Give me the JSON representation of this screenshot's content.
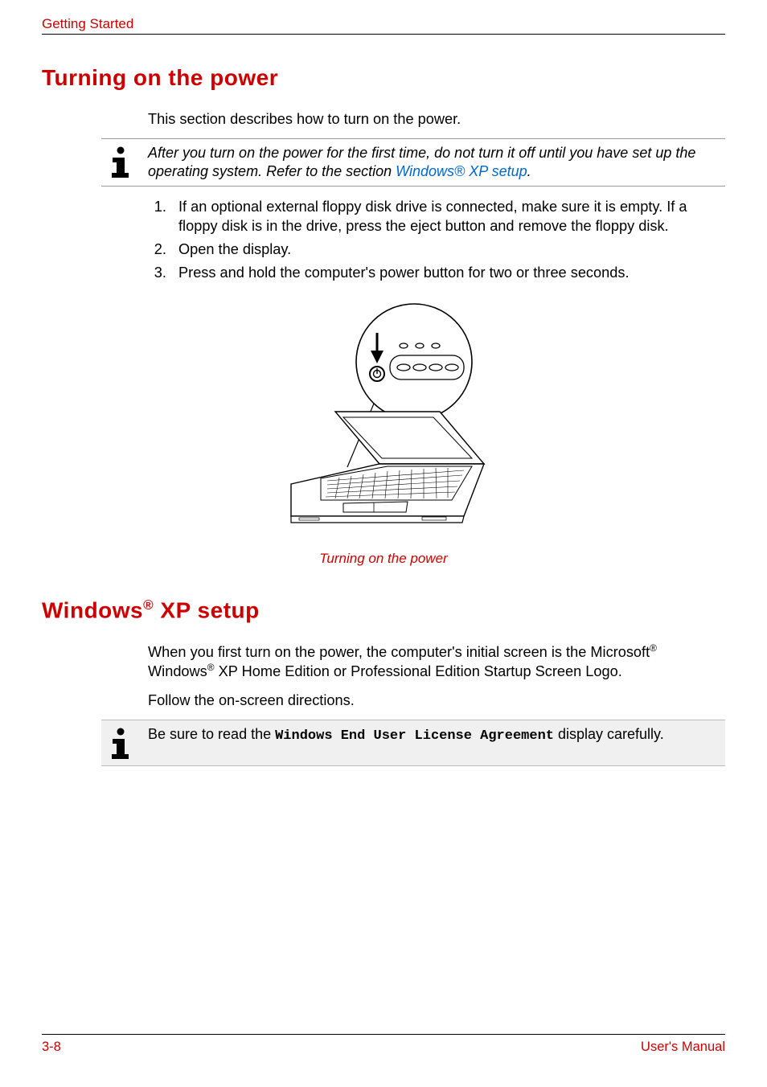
{
  "header": {
    "section": "Getting Started"
  },
  "h1_a": "Turning on the power",
  "intro_a": "This section describes how to turn on the power.",
  "note_a": {
    "pre": "After you turn on the power for the first time, do not turn it off until you have set up the operating system. Refer to the section ",
    "link": "Windows® XP setup",
    "post": "."
  },
  "steps": {
    "s1": "If an optional external floppy disk drive is connected, make sure it is empty. If a floppy disk is in the drive, press the eject button and remove the floppy disk.",
    "s2": "Open the display.",
    "s3": "Press and hold the computer's power button for two or three seconds."
  },
  "caption_a": "Turning on the power",
  "h1_b_pre": "Windows",
  "h1_b_sup": "®",
  "h1_b_post": " XP setup",
  "para_b1_pre": "When you first turn on the power, the computer's initial screen is the Microsoft",
  "para_b1_mid": " Windows",
  "para_b1_post": " XP Home Edition or Professional Edition Startup Screen Logo.",
  "para_b2": "Follow the on-screen directions.",
  "note_b": {
    "pre": "Be sure to read the ",
    "eula": "Windows End User License Agreement",
    "post": " display carefully."
  },
  "footer": {
    "left": "3-8",
    "right": "User's Manual"
  }
}
